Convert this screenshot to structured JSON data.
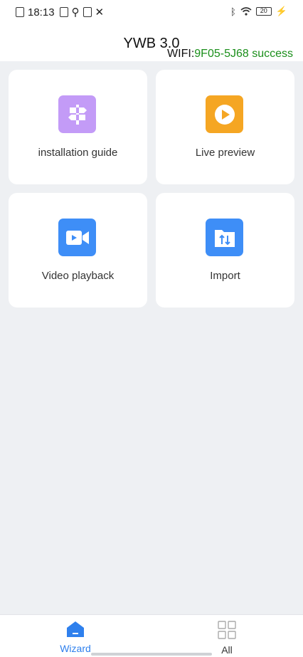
{
  "status_bar": {
    "time": "18:13",
    "battery": "20"
  },
  "header": {
    "title": "YWB 3.0",
    "wifi_label": "WIFI:",
    "wifi_value": "9F05-5J68 success"
  },
  "tiles": [
    {
      "label": "installation guide",
      "icon": "signpost-icon",
      "color": "#c39bf7"
    },
    {
      "label": "Live preview",
      "icon": "play-icon",
      "color": "#f5a623"
    },
    {
      "label": "Video playback",
      "icon": "video-camera-icon",
      "color": "#3e8ef7"
    },
    {
      "label": "Import",
      "icon": "folder-import-icon",
      "color": "#3e8ef7"
    }
  ],
  "bottom_nav": [
    {
      "label": "Wizard",
      "icon": "home-icon",
      "active": true,
      "color": "#2f80ed"
    },
    {
      "label": "All",
      "icon": "grid-icon",
      "active": false,
      "color": "#333333"
    }
  ]
}
